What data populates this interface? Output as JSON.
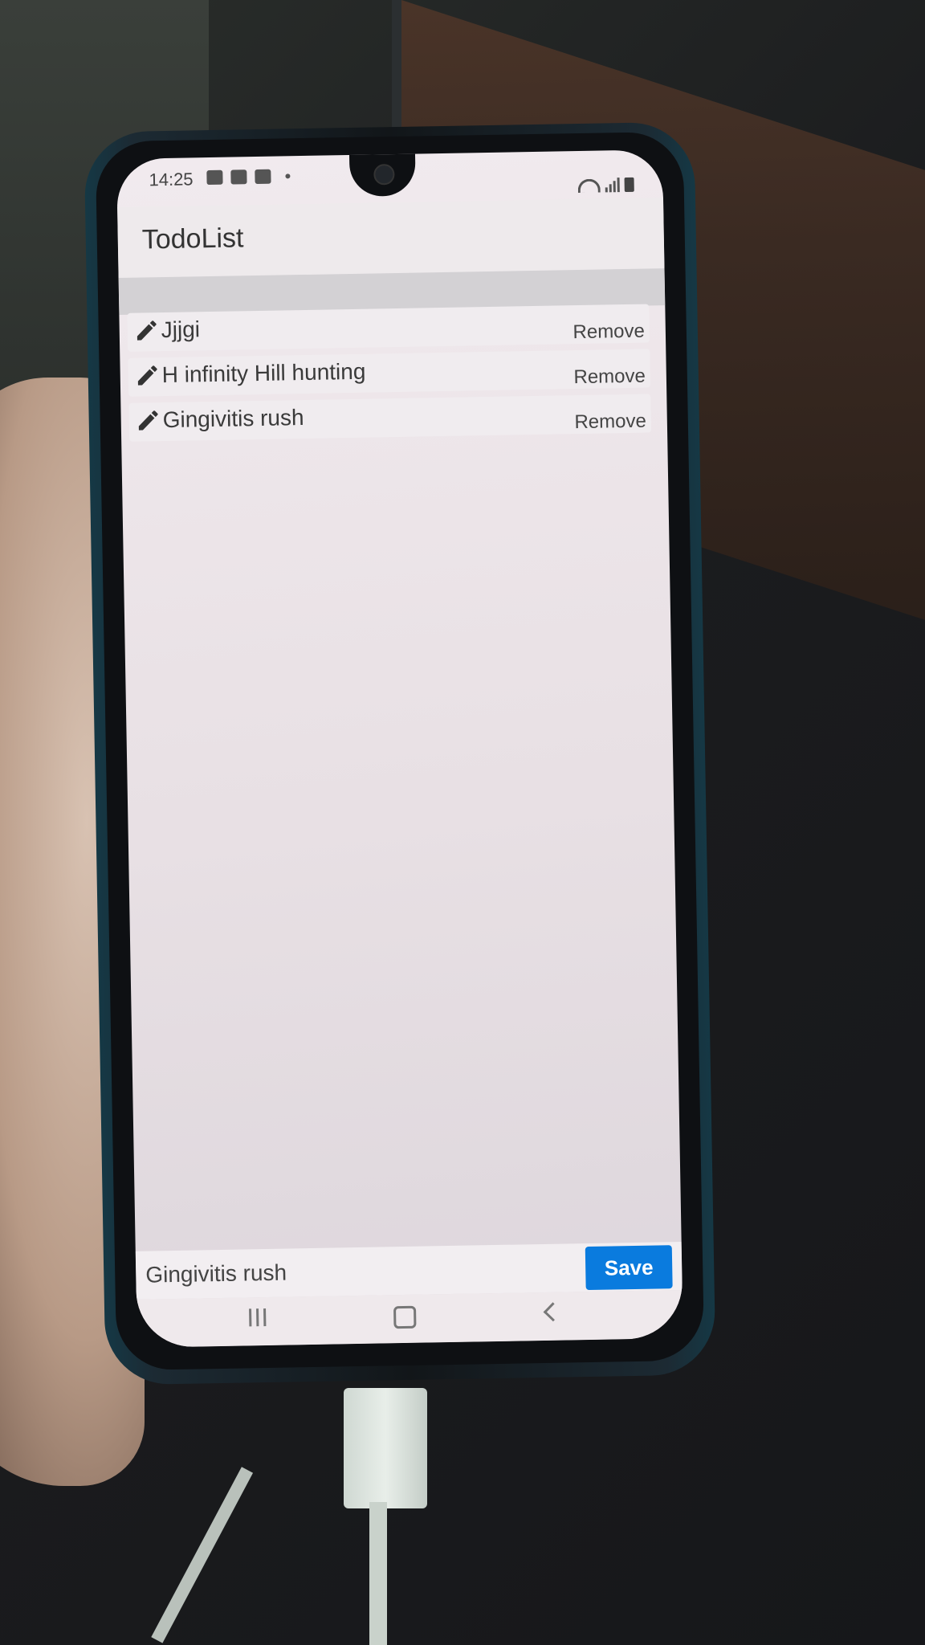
{
  "status_bar": {
    "time": "14:25"
  },
  "app": {
    "title": "TodoList"
  },
  "todos": [
    {
      "text": "Jjjgi",
      "remove_label": "Remove"
    },
    {
      "text": "H infinity Hill hunting",
      "remove_label": "Remove"
    },
    {
      "text": "Gingivitis rush",
      "remove_label": "Remove"
    }
  ],
  "input": {
    "value": "Gingivitis rush"
  },
  "save_label": "Save",
  "colors": {
    "save_button": "#0a7bde",
    "screen_bg": "#ece5e9",
    "appbar_bg": "#eeeaec"
  },
  "icons": {
    "edit": "pencil-icon",
    "nav_recent": "recent-apps-icon",
    "nav_home": "home-icon",
    "nav_back": "back-icon"
  }
}
